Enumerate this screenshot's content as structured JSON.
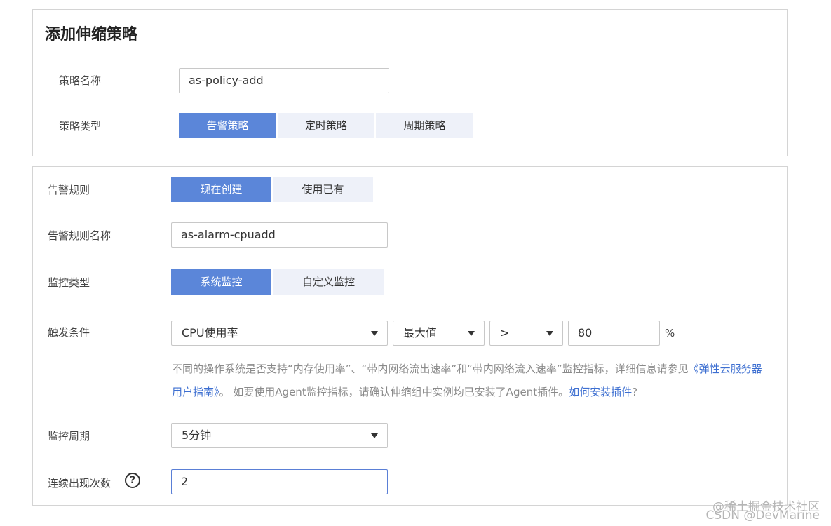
{
  "dialog": {
    "title": "添加伸缩策略",
    "policy_name_label": "策略名称",
    "policy_name_value": "as-policy-add",
    "policy_type_label": "策略类型",
    "policy_types": [
      "告警策略",
      "定时策略",
      "周期策略"
    ],
    "policy_type_selected": "告警策略"
  },
  "alarm": {
    "rule_label": "告警规则",
    "rule_options": [
      "现在创建",
      "使用已有"
    ],
    "rule_selected": "现在创建",
    "rule_name_label": "告警规则名称",
    "rule_name_value": "as-alarm-cpuadd",
    "monitor_type_label": "监控类型",
    "monitor_types": [
      "系统监控",
      "自定义监控"
    ],
    "monitor_type_selected": "系统监控",
    "trigger_label": "触发条件",
    "trigger_metric": "CPU使用率",
    "trigger_stat": "最大值",
    "trigger_operator": ">",
    "trigger_value": "80",
    "trigger_unit": "%",
    "hint_part1": "不同的操作系统是否支持“内存使用率”、“带内网络流出速率”和“带内网络流入速率”监控指标，详细信息请参见",
    "hint_link1": "《弹性云服务器用户指南》",
    "hint_part2": "。 如要使用Agent监控指标，请确认伸缩组中实例均已安装了Agent插件。",
    "hint_link2": "如何安装插件",
    "hint_part3": "?",
    "period_label": "监控周期",
    "period_value": "5分钟",
    "occurrences_label": "连续出现次数",
    "occurrences_value": "2"
  },
  "watermark": {
    "line1": "@稀土掘金技术社区",
    "line2": "CSDN @DevMarine"
  },
  "colors": {
    "primary": "#5b86d9",
    "segment_bg": "#eef1f9",
    "link": "#3d6fd1"
  }
}
